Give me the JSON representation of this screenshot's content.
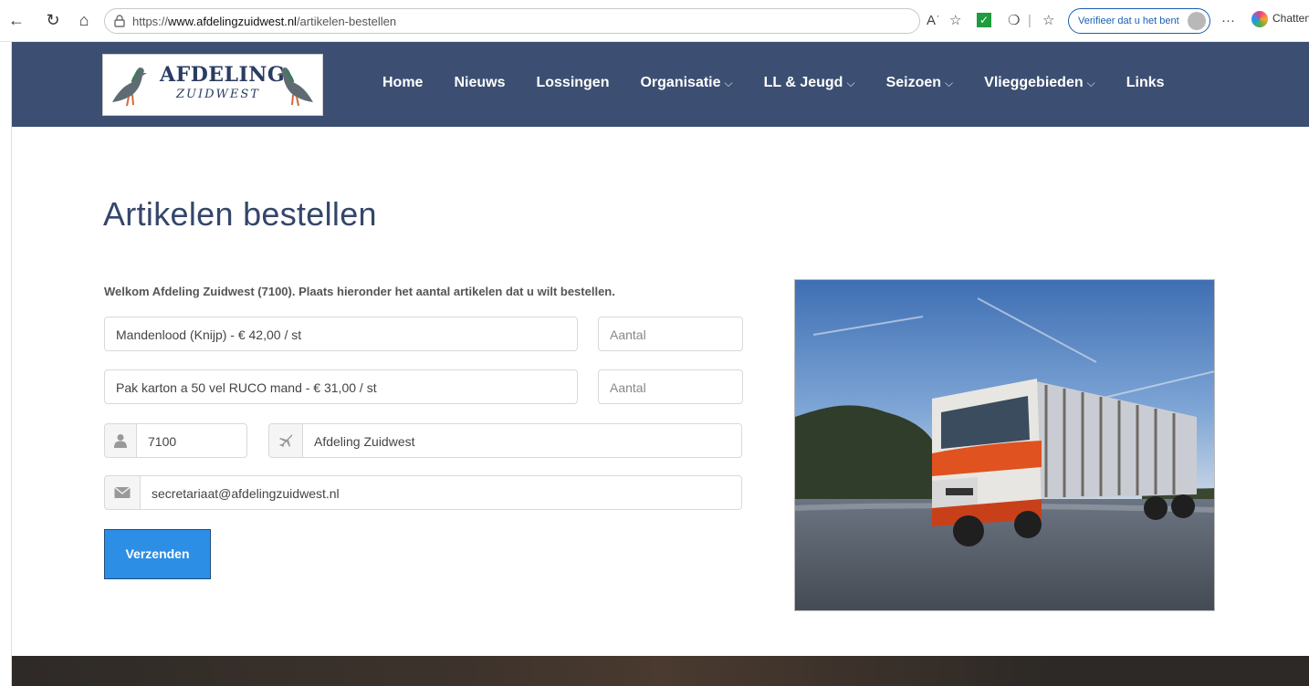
{
  "browser": {
    "url_prefix": "https://",
    "url_host": "www.afdelingzuidwest.nl",
    "url_path": "/artikelen-bestellen",
    "verify_label": "Verifieer dat u het bent",
    "chat_label": "Chatten"
  },
  "nav": {
    "logo_line1": "AFDELING",
    "logo_line2": "ZUIDWEST",
    "items": [
      {
        "label": "Home"
      },
      {
        "label": "Nieuws"
      },
      {
        "label": "Lossingen"
      },
      {
        "label": "Organisatie"
      },
      {
        "label": "LL & Jeugd"
      },
      {
        "label": "Seizoen"
      },
      {
        "label": "Vlieggebieden"
      },
      {
        "label": "Links"
      }
    ]
  },
  "main": {
    "title": "Artikelen bestellen",
    "welcome": "Welkom Afdeling Zuidwest (7100). Plaats hieronder het aantal artikelen dat u wilt bestellen.",
    "articles": [
      {
        "name": "Mandenlood (Knijp) - € 42,00 / st",
        "qty_placeholder": "Aantal"
      },
      {
        "name": "Pak karton a 50 vel RUCO mand - € 31,00 / st",
        "qty_placeholder": "Aantal"
      }
    ],
    "member_number": "7100",
    "department": "Afdeling Zuidwest",
    "email": "secretariaat@afdelingzuidwest.nl",
    "submit_label": "Verzenden"
  },
  "colors": {
    "nav_bg": "#3c4f72",
    "title": "#34466a",
    "button": "#2d8ee6"
  }
}
